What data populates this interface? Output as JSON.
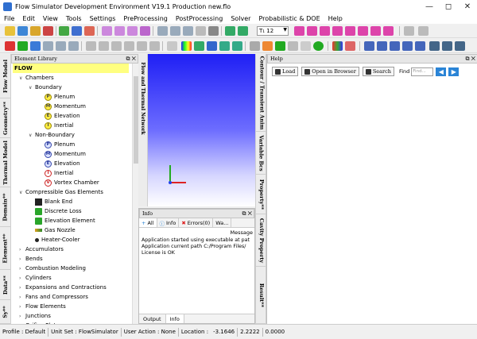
{
  "window": {
    "title": "Flow Simulator Development Environment V19.1 Production new.flo"
  },
  "menu": [
    "File",
    "Edit",
    "View",
    "Tools",
    "Settings",
    "PreProcessing",
    "PostProcessing",
    "Solver",
    "Probabilistic & DOE",
    "Help"
  ],
  "toolbar": {
    "font_value": "T₁ 12"
  },
  "left_tabs": [
    "Flow Model",
    "Geometry**",
    "Thermal Model",
    "Domain**",
    "Element**",
    "Data**",
    "Sy**"
  ],
  "mid_tabs": [
    "Contour / Transient Anim",
    "Variable Bcs",
    "Property**",
    "Cavity Property",
    "Result**"
  ],
  "element_library": {
    "title": "Element Library",
    "tree": [
      {
        "label": "FLOW",
        "level": 0,
        "type": "root"
      },
      {
        "label": "Chambers",
        "level": 1,
        "type": "expanded"
      },
      {
        "label": "Boundary",
        "level": 2,
        "type": "expanded"
      },
      {
        "label": "Plenum",
        "level": 3,
        "icon": "P",
        "color": "yel"
      },
      {
        "label": "Momentum",
        "level": 3,
        "icon": "M",
        "color": "yel"
      },
      {
        "label": "Elevation",
        "level": 3,
        "icon": "E",
        "color": "yel"
      },
      {
        "label": "Inertial",
        "level": 3,
        "icon": "I",
        "color": "yel"
      },
      {
        "label": "Non-Boundary",
        "level": 2,
        "type": "expanded"
      },
      {
        "label": "Plenum",
        "level": 3,
        "icon": "P",
        "color": "blu"
      },
      {
        "label": "Momentum",
        "level": 3,
        "icon": "M",
        "color": "blu"
      },
      {
        "label": "Elevation",
        "level": 3,
        "icon": "E",
        "color": "blu"
      },
      {
        "label": "Inertial",
        "level": 3,
        "icon": "I",
        "color": "red"
      },
      {
        "label": "Vortex Chamber",
        "level": 3,
        "icon": "V",
        "color": "red"
      },
      {
        "label": "Compressible Gas Elements",
        "level": 1,
        "type": "expanded"
      },
      {
        "label": "Blank End",
        "level": 2,
        "icon": "",
        "color": "blk"
      },
      {
        "label": "Discrete Loss",
        "level": 2,
        "icon": "",
        "color": "green"
      },
      {
        "label": "Elevation Element",
        "level": 2,
        "icon": "",
        "color": "green"
      },
      {
        "label": "Gas Nozzle",
        "level": 2,
        "icon": "",
        "color": "nozzle"
      },
      {
        "label": "Heater-Cooler",
        "level": 2,
        "icon": "",
        "color": "heater"
      },
      {
        "label": "Accumulators",
        "level": 1,
        "type": "collapsed"
      },
      {
        "label": "Bends",
        "level": 1,
        "type": "collapsed"
      },
      {
        "label": "Combustion Modeling",
        "level": 1,
        "type": "collapsed"
      },
      {
        "label": "Cylinders",
        "level": 1,
        "type": "collapsed"
      },
      {
        "label": "Expansions and Contractions",
        "level": 1,
        "type": "collapsed"
      },
      {
        "label": "Fans and Compressors",
        "level": 1,
        "type": "collapsed"
      },
      {
        "label": "Flow Elements",
        "level": 1,
        "type": "collapsed"
      },
      {
        "label": "Junctions",
        "level": 1,
        "type": "collapsed"
      },
      {
        "label": "Orifice Plates",
        "level": 1,
        "type": "collapsed"
      }
    ]
  },
  "side_band_label": "Flow and Thermal Network",
  "info": {
    "title": "Info",
    "tabs": [
      "All",
      "Info",
      "Errors(0)",
      "Wa..."
    ],
    "message_header": "Message",
    "messages": [
      "Application started using executable at pat",
      "Application current  path C:/Program Files/",
      "License is OK"
    ],
    "bottom_tabs": [
      "Output",
      "Info"
    ]
  },
  "help": {
    "title": "Help",
    "buttons": [
      "Load",
      "Open in Browser",
      "Search"
    ],
    "find_label": "Find",
    "find_placeholder": "Find..."
  },
  "status": {
    "profile": "Profile : Default",
    "unit_set": "Unit Set : FlowSimulator",
    "user_action": "User Action : None",
    "location_label": "Location :",
    "x": "-3.1646",
    "y": "2.2222",
    "z": "0.0000"
  },
  "colors": {
    "accent": "#2a84d6",
    "canvas_top": "#1f1ff5",
    "canvas_bottom": "#ffffff"
  }
}
